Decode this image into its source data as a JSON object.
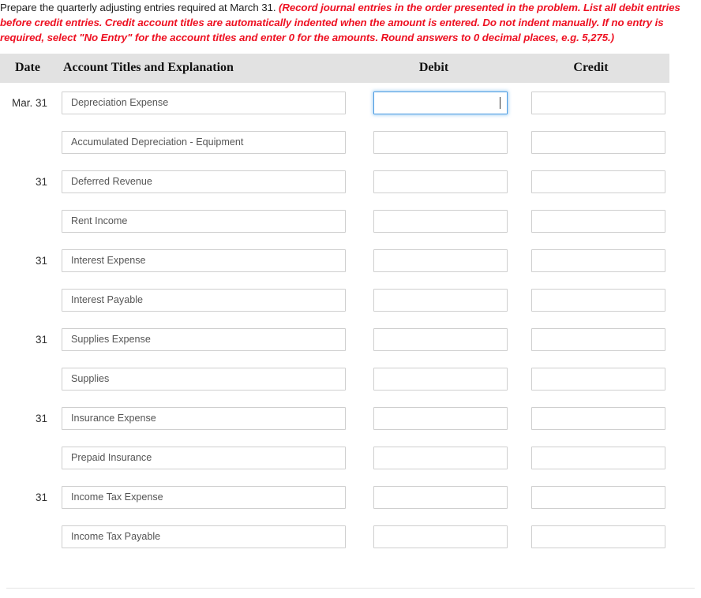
{
  "instructions": {
    "plain_text": "Prepare the quarterly adjusting entries required at March 31. ",
    "emphasis_text": "(Record journal entries in the order presented in the problem. List all debit entries before credit entries. Credit account titles are automatically indented when the amount is entered. Do not indent manually. If no entry is required, select \"No Entry\" for the account titles and enter 0 for the amounts. Round answers to 0 decimal places, e.g. 5,275.)",
    "emphasis_color": "#ee1122"
  },
  "table": {
    "headers": {
      "date": "Date",
      "account": "Account Titles and Explanation",
      "debit": "Debit",
      "credit": "Credit"
    },
    "header_background": "#e2e2e2",
    "focus_color": "#4a9ae1",
    "rows": [
      {
        "date": "Mar. 31",
        "account_value": "Depreciation Expense",
        "account_placeholder": "",
        "debit_value": "",
        "credit_value": "",
        "debit_focused": true
      },
      {
        "date": "",
        "account_value": "Accumulated Depreciation - Equipment",
        "account_placeholder": "",
        "debit_value": "",
        "credit_value": "",
        "debit_focused": false
      },
      {
        "date": "31",
        "account_value": "Deferred Revenue",
        "account_placeholder": "",
        "debit_value": "",
        "credit_value": "",
        "debit_focused": false
      },
      {
        "date": "",
        "account_value": "Rent Income",
        "account_placeholder": "",
        "debit_value": "",
        "credit_value": "",
        "debit_focused": false
      },
      {
        "date": "31",
        "account_value": "Interest Expense",
        "account_placeholder": "",
        "debit_value": "",
        "credit_value": "",
        "debit_focused": false
      },
      {
        "date": "",
        "account_value": "Interest Payable",
        "account_placeholder": "",
        "debit_value": "",
        "credit_value": "",
        "debit_focused": false
      },
      {
        "date": "31",
        "account_value": "Supplies Expense",
        "account_placeholder": "",
        "debit_value": "",
        "credit_value": "",
        "debit_focused": false
      },
      {
        "date": "",
        "account_value": "Supplies",
        "account_placeholder": "",
        "debit_value": "",
        "credit_value": "",
        "debit_focused": false
      },
      {
        "date": "31",
        "account_value": "Insurance Expense",
        "account_placeholder": "",
        "debit_value": "",
        "credit_value": "",
        "debit_focused": false
      },
      {
        "date": "",
        "account_value": "Prepaid Insurance",
        "account_placeholder": "",
        "debit_value": "",
        "credit_value": "",
        "debit_focused": false
      },
      {
        "date": "31",
        "account_value": "Income Tax Expense",
        "account_placeholder": "",
        "debit_value": "",
        "credit_value": "",
        "debit_focused": false
      },
      {
        "date": "",
        "account_value": "Income Tax Payable",
        "account_placeholder": "",
        "debit_value": "",
        "credit_value": "",
        "debit_focused": false
      }
    ]
  }
}
